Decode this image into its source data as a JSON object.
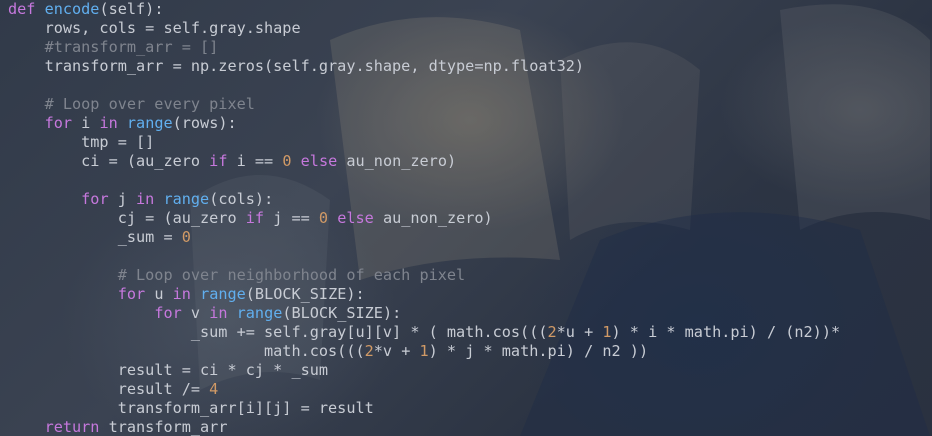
{
  "editor": {
    "lines": [
      [
        {
          "t": "def",
          "k": "kw"
        },
        {
          "t": " ",
          "k": "txt"
        },
        {
          "t": "encode",
          "k": "fn"
        },
        {
          "t": "(self):",
          "k": "txt"
        }
      ],
      [
        {
          "t": "    rows, cols = self.gray.shape",
          "k": "txt"
        }
      ],
      [
        {
          "t": "    #transform_arr = []",
          "k": "cmt"
        }
      ],
      [
        {
          "t": "    transform_arr = np.zeros(self.gray.shape, dtype=np.float32)",
          "k": "txt"
        }
      ],
      [],
      [
        {
          "t": "    # Loop over every pixel",
          "k": "cmt"
        }
      ],
      [
        {
          "t": "    ",
          "k": "txt"
        },
        {
          "t": "for",
          "k": "kw"
        },
        {
          "t": " i ",
          "k": "txt"
        },
        {
          "t": "in",
          "k": "kw"
        },
        {
          "t": " ",
          "k": "txt"
        },
        {
          "t": "range",
          "k": "fn"
        },
        {
          "t": "(rows):",
          "k": "txt"
        }
      ],
      [
        {
          "t": "        tmp = []",
          "k": "txt"
        }
      ],
      [
        {
          "t": "        ci = (au_zero ",
          "k": "txt"
        },
        {
          "t": "if",
          "k": "kw"
        },
        {
          "t": " i == ",
          "k": "txt"
        },
        {
          "t": "0",
          "k": "num"
        },
        {
          "t": " ",
          "k": "txt"
        },
        {
          "t": "else",
          "k": "kw"
        },
        {
          "t": " au_non_zero)",
          "k": "txt"
        }
      ],
      [],
      [
        {
          "t": "        ",
          "k": "txt"
        },
        {
          "t": "for",
          "k": "kw"
        },
        {
          "t": " j ",
          "k": "txt"
        },
        {
          "t": "in",
          "k": "kw"
        },
        {
          "t": " ",
          "k": "txt"
        },
        {
          "t": "range",
          "k": "fn"
        },
        {
          "t": "(cols):",
          "k": "txt"
        }
      ],
      [
        {
          "t": "            cj = (au_zero ",
          "k": "txt"
        },
        {
          "t": "if",
          "k": "kw"
        },
        {
          "t": " j == ",
          "k": "txt"
        },
        {
          "t": "0",
          "k": "num"
        },
        {
          "t": " ",
          "k": "txt"
        },
        {
          "t": "else",
          "k": "kw"
        },
        {
          "t": " au_non_zero)",
          "k": "txt"
        }
      ],
      [
        {
          "t": "            _sum = ",
          "k": "txt"
        },
        {
          "t": "0",
          "k": "num"
        }
      ],
      [],
      [
        {
          "t": "            # Loop over neighborhood of each pixel",
          "k": "cmt"
        }
      ],
      [
        {
          "t": "            ",
          "k": "txt"
        },
        {
          "t": "for",
          "k": "kw"
        },
        {
          "t": " u ",
          "k": "txt"
        },
        {
          "t": "in",
          "k": "kw"
        },
        {
          "t": " ",
          "k": "txt"
        },
        {
          "t": "range",
          "k": "fn"
        },
        {
          "t": "(BLOCK_SIZE):",
          "k": "txt"
        }
      ],
      [
        {
          "t": "                ",
          "k": "txt"
        },
        {
          "t": "for",
          "k": "kw"
        },
        {
          "t": " v ",
          "k": "txt"
        },
        {
          "t": "in",
          "k": "kw"
        },
        {
          "t": " ",
          "k": "txt"
        },
        {
          "t": "range",
          "k": "fn"
        },
        {
          "t": "(BLOCK_SIZE):",
          "k": "txt"
        }
      ],
      [
        {
          "t": "                    _sum += self.gray[u][v] * ( math.cos(((",
          "k": "txt"
        },
        {
          "t": "2",
          "k": "num"
        },
        {
          "t": "*u + ",
          "k": "txt"
        },
        {
          "t": "1",
          "k": "num"
        },
        {
          "t": ") * i * math.pi) / (n2))*",
          "k": "txt"
        }
      ],
      [
        {
          "t": "                            math.cos(((",
          "k": "txt"
        },
        {
          "t": "2",
          "k": "num"
        },
        {
          "t": "*v + ",
          "k": "txt"
        },
        {
          "t": "1",
          "k": "num"
        },
        {
          "t": ") * j * math.pi) / n2 ))",
          "k": "txt"
        }
      ],
      [
        {
          "t": "            result = ci * cj * _sum",
          "k": "txt"
        }
      ],
      [
        {
          "t": "            result /= ",
          "k": "txt"
        },
        {
          "t": "4",
          "k": "num"
        }
      ],
      [
        {
          "t": "            transform_arr[i][j] = result",
          "k": "txt"
        }
      ],
      [
        {
          "t": "    ",
          "k": "txt"
        },
        {
          "t": "return",
          "k": "kw"
        },
        {
          "t": " transform_arr",
          "k": "txt"
        }
      ]
    ]
  },
  "theme": {
    "keyword": "#c678dd",
    "function": "#61afef",
    "number": "#d19a66",
    "comment": "#7f848e",
    "text": "#c8ccd4",
    "background": "#2f3746"
  }
}
